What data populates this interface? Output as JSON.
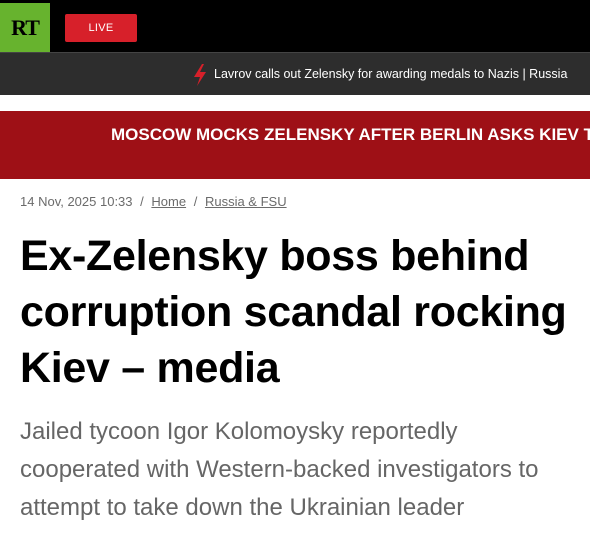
{
  "header": {
    "logo_text": "RT",
    "logo_color": "#67b32e",
    "live_label": "LIVE",
    "live_color": "#d7202a"
  },
  "ticker": {
    "icon": "lightning-icon",
    "text": "Lavrov calls out Zelensky for awarding medals to Nazis | Russia"
  },
  "banner": {
    "text": "MOSCOW MOCKS ZELENSKY AFTER BERLIN ASKS KIEV TO RETAIN ITS MALES",
    "color": "#9e1016"
  },
  "article": {
    "date": "14 Nov, 2025 10:33",
    "breadcrumb": [
      "Home",
      "Russia & FSU"
    ],
    "headline": "Ex-Zelensky boss behind corruption scandal rocking Kiev – media",
    "summary": "Jailed tycoon Igor Kolomoysky reportedly cooperated with Western-backed investigators to attempt to take down the Ukrainian leader"
  }
}
